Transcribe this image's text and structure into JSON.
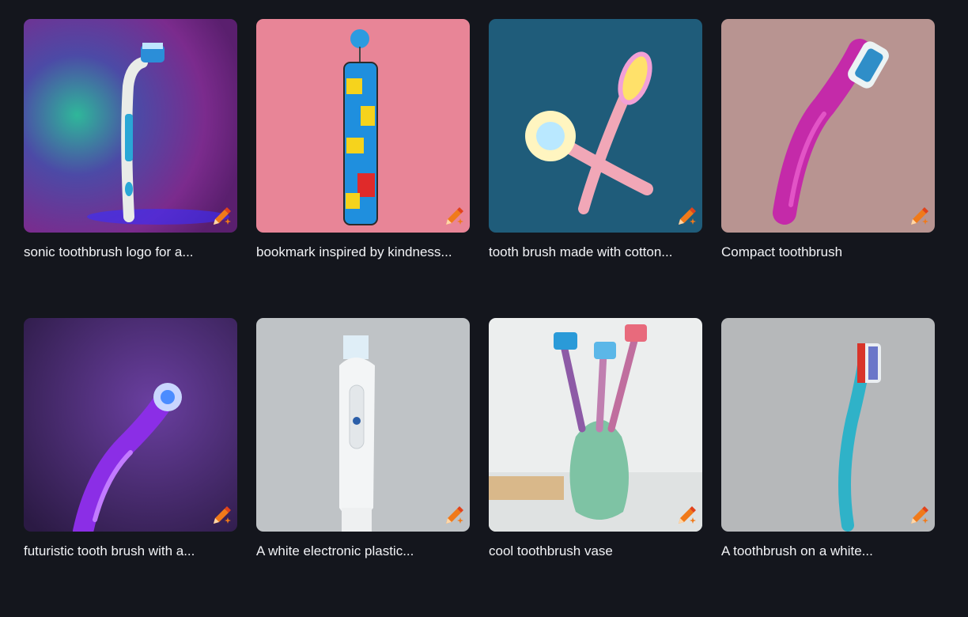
{
  "cards": [
    {
      "title": "sonic toothbrush logo for a..."
    },
    {
      "title": "bookmark inspired by kindness..."
    },
    {
      "title": "tooth brush made with cotton..."
    },
    {
      "title": "Compact toothbrush"
    },
    {
      "title": "futuristic tooth brush with a..."
    },
    {
      "title": "A white electronic plastic..."
    },
    {
      "title": "cool toothbrush vase"
    },
    {
      "title": "A toothbrush on a white..."
    }
  ],
  "icons": {
    "edit": "pencil-sparkle-icon"
  },
  "colors": {
    "background": "#14161d",
    "caption": "#f2f3f6",
    "edit_icon": "#f07a1a"
  }
}
